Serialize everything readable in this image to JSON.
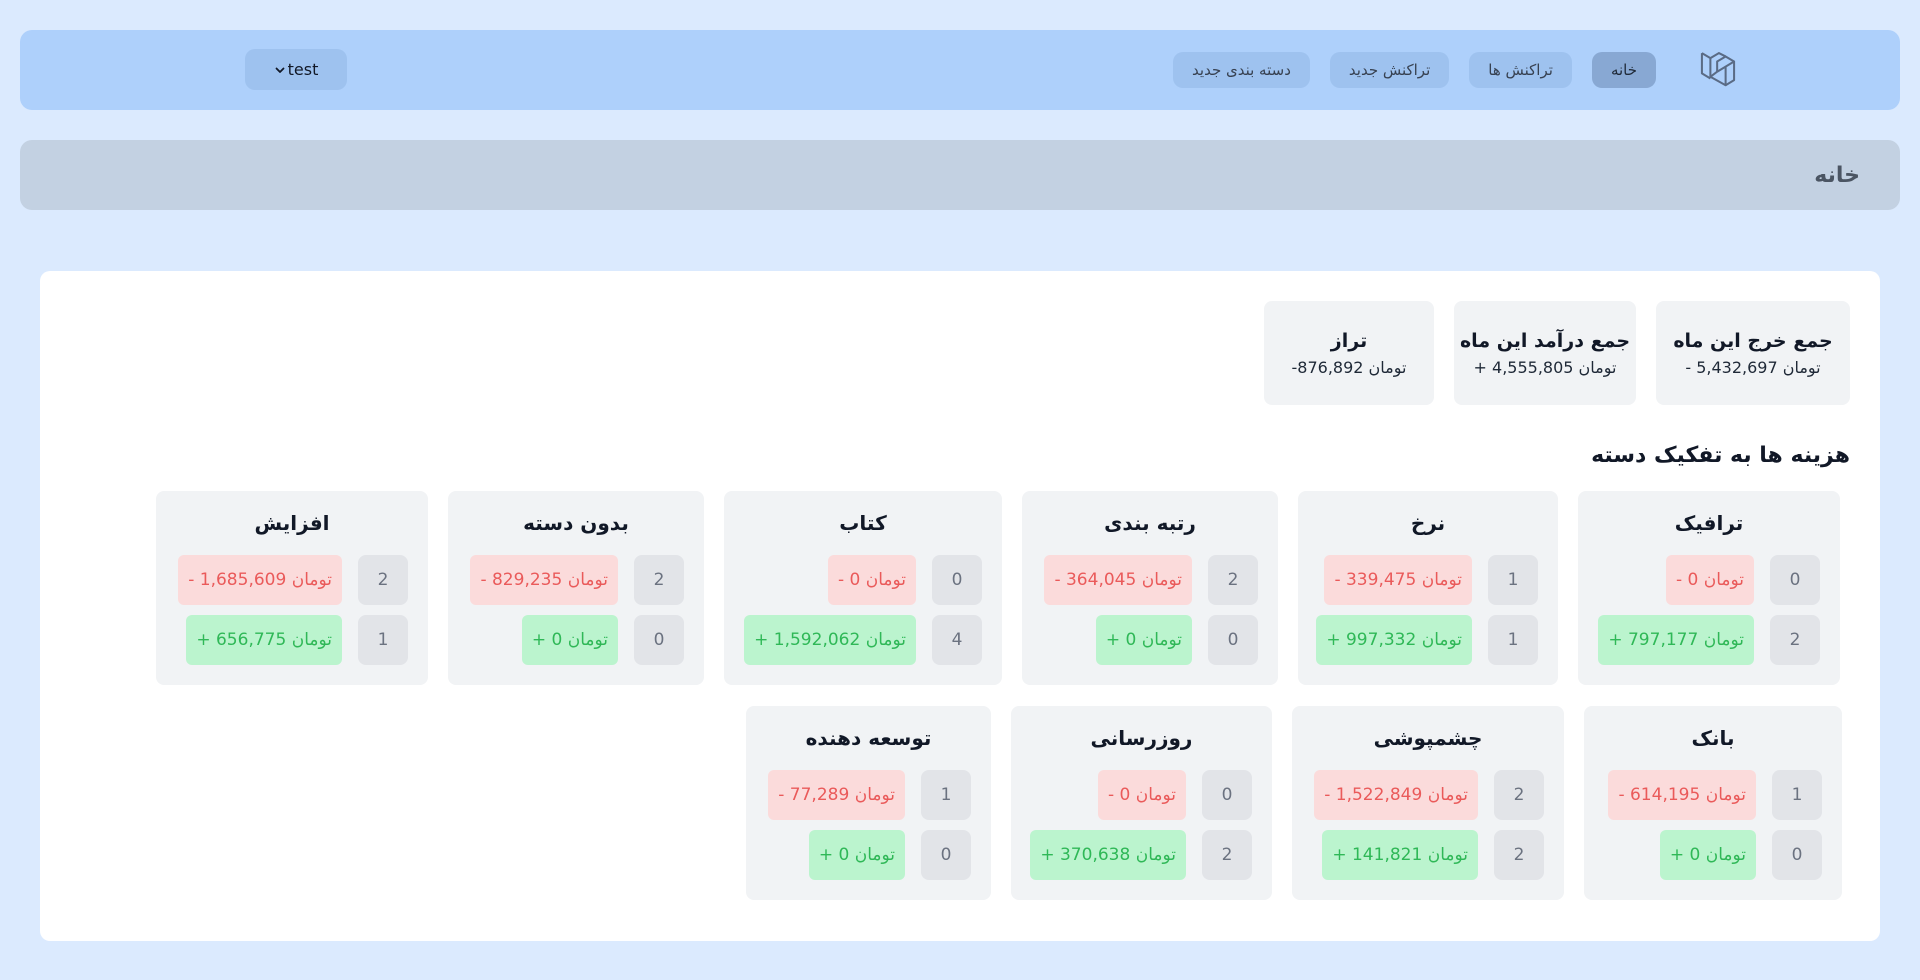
{
  "nav": {
    "links": [
      {
        "label": "خانه",
        "active": true
      },
      {
        "label": "تراکنش ها",
        "active": false
      },
      {
        "label": "تراکنش جدید",
        "active": false
      },
      {
        "label": "دسته بندی جدید",
        "active": false
      }
    ],
    "user_label": "test",
    "logo_icon": "laravel-logo-icon",
    "user_menu_icon": "chevron-down-icon"
  },
  "header": {
    "title": "خانه"
  },
  "summary": [
    {
      "title": "جمع خرج این ماه",
      "value": "- 5,432,697 تومان"
    },
    {
      "title": "جمع درآمد این ماه",
      "value": "+ 4,555,805 تومان"
    },
    {
      "title": "تراز",
      "value": "-876,892 تومان"
    }
  ],
  "section_title": "هزینه ها به تفکیک دسته",
  "categories": [
    {
      "name": "ترافیک",
      "expense_count": "0",
      "expense": "- 0 تومان",
      "income_count": "2",
      "income": "+ 797,177 تومان"
    },
    {
      "name": "نرخ",
      "expense_count": "1",
      "expense": "- 339,475 تومان",
      "income_count": "1",
      "income": "+ 997,332 تومان"
    },
    {
      "name": "رتبه بندی",
      "expense_count": "2",
      "expense": "- 364,045 تومان",
      "income_count": "0",
      "income": "+ 0 تومان"
    },
    {
      "name": "کتاب",
      "expense_count": "0",
      "expense": "- 0 تومان",
      "income_count": "4",
      "income": "+ 1,592,062 تومان"
    },
    {
      "name": "بدون دسته",
      "expense_count": "2",
      "expense": "- 829,235 تومان",
      "income_count": "0",
      "income": "+ 0 تومان"
    },
    {
      "name": "افزایش",
      "expense_count": "2",
      "expense": "- 1,685,609 تومان",
      "income_count": "1",
      "income": "+ 656,775 تومان"
    },
    {
      "name": "بانک",
      "expense_count": "1",
      "expense": "- 614,195 تومان",
      "income_count": "0",
      "income": "+ 0 تومان"
    },
    {
      "name": "چشمپوشی",
      "expense_count": "2",
      "expense": "- 1,522,849 تومان",
      "income_count": "2",
      "income": "+ 141,821 تومان"
    },
    {
      "name": "روزرسانی",
      "expense_count": "0",
      "expense": "- 0 تومان",
      "income_count": "2",
      "income": "+ 370,638 تومان"
    },
    {
      "name": "توسعه دهنده",
      "expense_count": "1",
      "expense": "- 77,289 تومان",
      "income_count": "0",
      "income": "+ 0 تومان"
    }
  ],
  "colors": {
    "expense_bg": "#fbdbdb",
    "expense_text": "#ea5a5a",
    "income_bg": "#bbf4ce",
    "income_text": "#2fb857"
  }
}
